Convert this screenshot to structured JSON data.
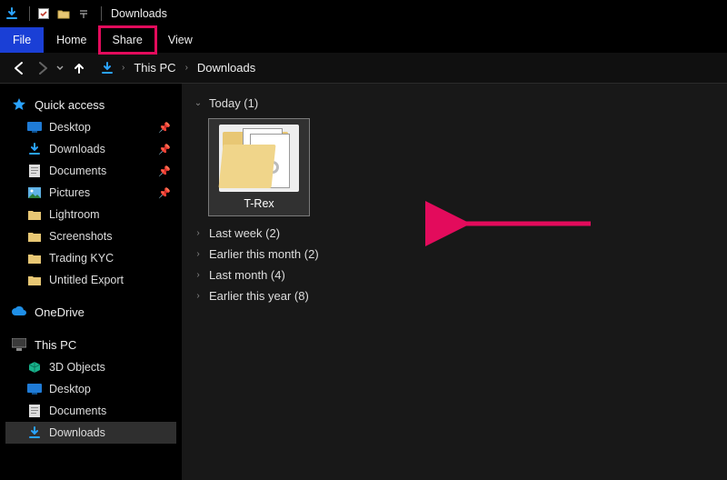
{
  "titlebar": {
    "title": "Downloads"
  },
  "tabs": {
    "file": "File",
    "home": "Home",
    "share": "Share",
    "view": "View"
  },
  "breadcrumb": {
    "items": [
      "This PC",
      "Downloads"
    ]
  },
  "sidebar": {
    "quick_access": {
      "label": "Quick access",
      "items": [
        {
          "label": "Desktop",
          "icon": "desktop",
          "pinned": true
        },
        {
          "label": "Downloads",
          "icon": "download",
          "pinned": true
        },
        {
          "label": "Documents",
          "icon": "document",
          "pinned": true
        },
        {
          "label": "Pictures",
          "icon": "pictures",
          "pinned": true
        },
        {
          "label": "Lightroom",
          "icon": "folder"
        },
        {
          "label": "Screenshots",
          "icon": "folder"
        },
        {
          "label": "Trading KYC",
          "icon": "folder"
        },
        {
          "label": "Untitled Export",
          "icon": "folder"
        }
      ]
    },
    "onedrive": {
      "label": "OneDrive"
    },
    "this_pc": {
      "label": "This PC",
      "items": [
        {
          "label": "3D Objects",
          "icon": "objects3d"
        },
        {
          "label": "Desktop",
          "icon": "desktop"
        },
        {
          "label": "Documents",
          "icon": "document"
        },
        {
          "label": "Downloads",
          "icon": "download",
          "selected": true
        }
      ]
    }
  },
  "content": {
    "groups": [
      {
        "label": "Today (1)",
        "expanded": true,
        "items": [
          {
            "label": "T-Rex",
            "selected": true
          }
        ]
      },
      {
        "label": "Last week (2)"
      },
      {
        "label": "Earlier this month (2)"
      },
      {
        "label": "Last month (4)"
      },
      {
        "label": "Earlier this year (8)"
      }
    ]
  },
  "colors": {
    "accent": "#1a3fd6",
    "highlight": "#e30b5c"
  }
}
